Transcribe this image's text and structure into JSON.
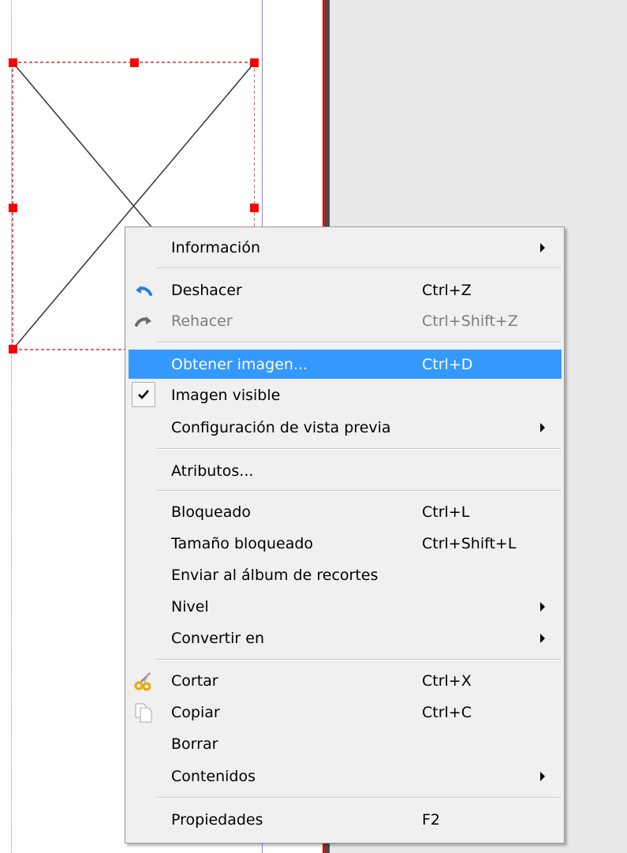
{
  "menu": {
    "info": {
      "label": "Información",
      "shortcut": ""
    },
    "undo": {
      "label": "Deshacer",
      "shortcut": "Ctrl+Z"
    },
    "redo": {
      "label": "Rehacer",
      "shortcut": "Ctrl+Shift+Z"
    },
    "get_image": {
      "label": "Obtener imagen...",
      "shortcut": "Ctrl+D"
    },
    "image_visible": {
      "label": "Imagen visible",
      "shortcut": "",
      "checked": true
    },
    "preview_settings": {
      "label": "Configuración de vista previa",
      "shortcut": ""
    },
    "attributes": {
      "label": "Atributos...",
      "shortcut": ""
    },
    "locked": {
      "label": "Bloqueado",
      "shortcut": "Ctrl+L"
    },
    "size_locked": {
      "label": "Tamaño bloqueado",
      "shortcut": "Ctrl+Shift+L"
    },
    "send_scrapbook": {
      "label": "Enviar al álbum de recortes",
      "shortcut": ""
    },
    "level": {
      "label": "Nivel",
      "shortcut": ""
    },
    "convert_to": {
      "label": "Convertir en",
      "shortcut": ""
    },
    "cut": {
      "label": "Cortar",
      "shortcut": "Ctrl+X"
    },
    "copy": {
      "label": "Copiar",
      "shortcut": "Ctrl+C"
    },
    "delete": {
      "label": "Borrar",
      "shortcut": ""
    },
    "contents": {
      "label": "Contenidos",
      "shortcut": ""
    },
    "properties": {
      "label": "Propiedades",
      "shortcut": "F2"
    }
  },
  "icons": {
    "undo": "undo-arrow-icon",
    "redo": "redo-arrow-icon",
    "check": "checkmark-icon",
    "cut": "scissors-icon",
    "copy": "copy-pages-icon",
    "submenu": "submenu-arrow-icon"
  },
  "colors": {
    "highlight": "#3399ff",
    "menu_background": "#f0f0f0",
    "selection_handle": "#ff0000",
    "page_edge": "#e01010"
  }
}
